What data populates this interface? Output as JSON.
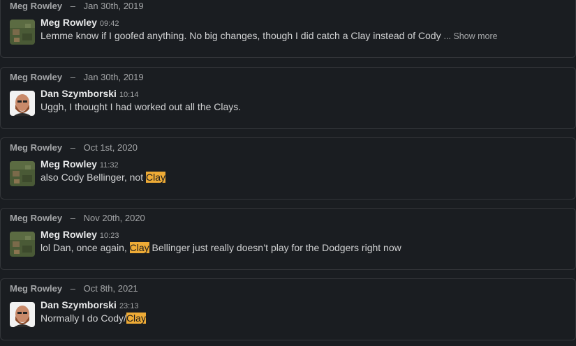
{
  "messages": [
    {
      "header_name": "Meg Rowley",
      "separator": "–",
      "header_date": "Jan 30th, 2019",
      "author": "Meg Rowley",
      "time": "09:42",
      "avatar": "grass-photo-avatar",
      "text_before": "Lemme know if I goofed anything. No big changes, though I did catch a Clay instead of Cody ",
      "show_more": "... Show more"
    },
    {
      "header_name": "Meg Rowley",
      "separator": "–",
      "header_date": "Jan 30th, 2019",
      "author": "Dan Szymborski",
      "time": "10:14",
      "avatar": "bearded-man-avatar",
      "text_before": "Uggh, I thought I had worked out all the Clays."
    },
    {
      "header_name": "Meg Rowley",
      "separator": "–",
      "header_date": "Oct 1st, 2020",
      "author": "Meg Rowley",
      "time": "11:32",
      "avatar": "grass-photo-avatar",
      "text_before": "also Cody Bellinger, not ",
      "highlight": "Clay",
      "text_after": ""
    },
    {
      "header_name": "Meg Rowley",
      "separator": "–",
      "header_date": "Nov 20th, 2020",
      "author": "Meg Rowley",
      "time": "10:23",
      "avatar": "grass-photo-avatar",
      "text_before": "lol Dan, once again, ",
      "highlight": "Clay",
      "text_after": " Bellinger just really doesn’t play for the Dodgers right now"
    },
    {
      "header_name": "Meg Rowley",
      "separator": "–",
      "header_date": "Oct 8th, 2021",
      "author": "Dan Szymborski",
      "time": "23:13",
      "avatar": "bearded-man-avatar",
      "text_before": "Normally I do Cody/",
      "highlight": "Clay",
      "text_after": ""
    }
  ],
  "colors": {
    "background": "#1a1d21",
    "card_border": "#34363a",
    "highlight": "#eeab36",
    "muted_text": "#a4a6a8"
  }
}
